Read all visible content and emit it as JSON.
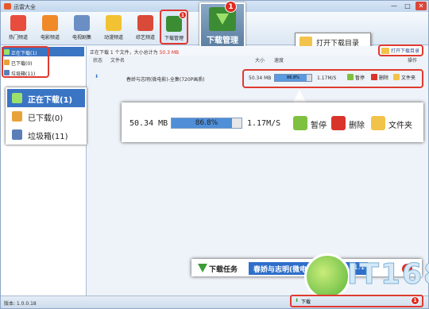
{
  "window": {
    "title": "迅雷大全",
    "min": "—",
    "max": "□",
    "close": "✕"
  },
  "toolbar": {
    "items": [
      {
        "label": "热门频道",
        "color": "#e84c3d"
      },
      {
        "label": "电影频道",
        "color": "#f08a28"
      },
      {
        "label": "电视剧集",
        "color": "#6b8fc4"
      },
      {
        "label": "动漫频道",
        "color": "#f1c232"
      },
      {
        "label": "综艺频道",
        "color": "#d94a38"
      },
      {
        "label": "下载管理",
        "color": "#3c8c33",
        "badge": "1"
      }
    ]
  },
  "callouts": {
    "download_manager": {
      "label": "下载管理",
      "badge": "1"
    },
    "open_dir": "打开下载目录"
  },
  "status": {
    "prefix": "正在下载 1 个文件，大小总计为",
    "size": "50.3 MB"
  },
  "open_dir_link": "打开下载目录",
  "sidebar": {
    "items": [
      {
        "label": "正在下载(1)",
        "color": "#3c9c36"
      },
      {
        "label": "已下载(0)",
        "color": "#e8a23a"
      },
      {
        "label": "垃圾箱(11)",
        "color": "#5a7fb8"
      }
    ]
  },
  "sidebar_callout": {
    "items": [
      {
        "label": "正在下载(1)",
        "color": "#3c9c36"
      },
      {
        "label": "已下载(0)",
        "color": "#e8a23a"
      },
      {
        "label": "垃圾箱(11)",
        "color": "#5a7fb8"
      }
    ]
  },
  "columns": {
    "status": "状态",
    "filename": "文件名",
    "size": "大小",
    "speed": "速度",
    "ops": "操作"
  },
  "task": {
    "name": "春娇与志明(微电影)-全集(720P画质)",
    "size": "50.34 MB",
    "progress": "86.8%",
    "progress_value": 86.8,
    "speed": "1.17M/S",
    "pause": "暂停",
    "delete": "删除",
    "folder": "文件夹"
  },
  "download_task_bar": {
    "label": "下载任务",
    "name": "春娇与志明(微电",
    "speed": "1.17M/S",
    "badge": "1"
  },
  "bottom": {
    "version": "版本: 1.0.0.18",
    "label": "下载",
    "badge": "1"
  },
  "watermark": {
    "text": "IT168"
  },
  "colors": {
    "accent": "#3a75c4",
    "highlight": "#e03a30",
    "progress": "#4f8fd8"
  }
}
